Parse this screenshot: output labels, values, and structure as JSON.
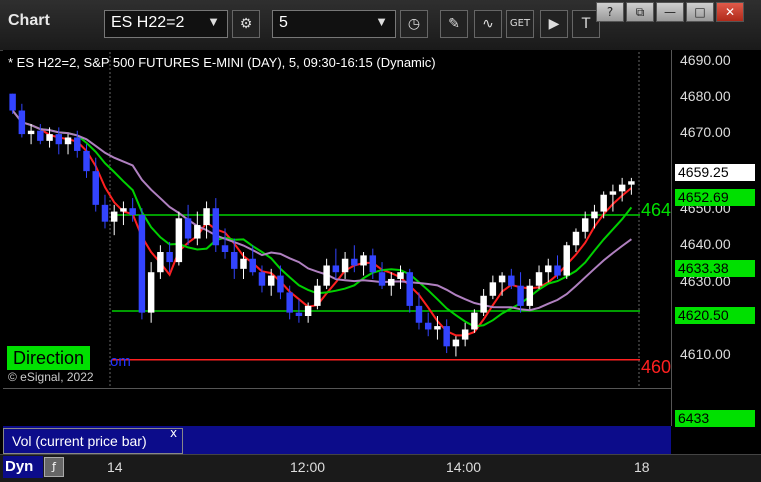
{
  "window": {
    "title": "Chart",
    "symbol": "ES H22=2",
    "interval": "5",
    "controls": [
      "?",
      "⧉",
      "—",
      "□",
      "✕"
    ]
  },
  "toolbar": {
    "icons": [
      "settings-icon",
      "clock-icon",
      "pencil-icon",
      "indicator-icon",
      "get-icon",
      "play-icon",
      "text-icon"
    ]
  },
  "chart": {
    "header": "* ES H22=2, S&P 500 FUTURES E-MINI (DAY), 5, 09:30-16:15 (Dynamic)",
    "direction_label": "Direction",
    "partial_text": "om",
    "copyright": "© eSignal, 2022",
    "y_ticks": [
      "4690.00",
      "4680.00",
      "4670.00",
      "4650.00",
      "4640.00",
      "4630.00",
      "4610.00"
    ],
    "price_tags": {
      "current": "4659.25",
      "upper_line": "4652.69",
      "ma": "4633.38",
      "lower_line": "4620.50"
    },
    "cut_labels": {
      "green": "464",
      "red": "460"
    },
    "colors": {
      "green": "#00d000",
      "red": "#ff2020",
      "blue": "#3344ff",
      "magenta": "#b080c0"
    }
  },
  "volume": {
    "label": "Vol (current price bar)",
    "close": "x",
    "value": "6433"
  },
  "bottom": {
    "dyn": "Dyn",
    "fx_icon": "function-icon",
    "x_ticks": [
      "14",
      "12:00",
      "14:00",
      "18"
    ]
  },
  "chart_data": {
    "type": "candlestick",
    "title": "ES H22=2, S&P 500 FUTURES E-MINI (DAY), 5, 09:30-16:15 (Dynamic)",
    "y_range": [
      4600,
      4695
    ],
    "x_ticks": [
      "14",
      "12:00",
      "14:00",
      "18"
    ],
    "candles": [
      [
        4685,
        4685,
        4679,
        4680
      ],
      [
        4680,
        4682,
        4672,
        4673
      ],
      [
        4673,
        4676,
        4670,
        4674
      ],
      [
        4674,
        4676,
        4670,
        4671
      ],
      [
        4671,
        4675,
        4669,
        4673
      ],
      [
        4673,
        4675,
        4667,
        4670
      ],
      [
        4670,
        4673,
        4667,
        4672
      ],
      [
        4672,
        4674,
        4666,
        4668
      ],
      [
        4668,
        4670,
        4660,
        4662
      ],
      [
        4662,
        4666,
        4650,
        4652
      ],
      [
        4652,
        4655,
        4645,
        4647
      ],
      [
        4647,
        4652,
        4643,
        4650
      ],
      [
        4650,
        4653,
        4646,
        4651
      ],
      [
        4651,
        4654,
        4647,
        4649
      ],
      [
        4649,
        4651,
        4618,
        4620
      ],
      [
        4620,
        4635,
        4617,
        4632
      ],
      [
        4632,
        4640,
        4630,
        4638
      ],
      [
        4638,
        4641,
        4632,
        4635
      ],
      [
        4635,
        4650,
        4634,
        4648
      ],
      [
        4648,
        4652,
        4640,
        4642
      ],
      [
        4642,
        4650,
        4640,
        4646
      ],
      [
        4646,
        4653,
        4642,
        4651
      ],
      [
        4651,
        4654,
        4638,
        4640
      ],
      [
        4640,
        4645,
        4636,
        4638
      ],
      [
        4638,
        4642,
        4630,
        4633
      ],
      [
        4633,
        4638,
        4630,
        4636
      ],
      [
        4636,
        4640,
        4631,
        4632
      ],
      [
        4632,
        4634,
        4626,
        4628
      ],
      [
        4628,
        4633,
        4625,
        4631
      ],
      [
        4631,
        4634,
        4624,
        4626
      ],
      [
        4626,
        4628,
        4618,
        4620
      ],
      [
        4620,
        4624,
        4617,
        4619
      ],
      [
        4619,
        4623,
        4617,
        4622
      ],
      [
        4622,
        4630,
        4621,
        4628
      ],
      [
        4628,
        4636,
        4627,
        4634
      ],
      [
        4634,
        4639,
        4630,
        4632
      ],
      [
        4632,
        4638,
        4630,
        4636
      ],
      [
        4636,
        4640,
        4632,
        4634
      ],
      [
        4634,
        4638,
        4631,
        4637
      ],
      [
        4637,
        4639,
        4630,
        4632
      ],
      [
        4632,
        4635,
        4627,
        4628
      ],
      [
        4628,
        4632,
        4625,
        4630
      ],
      [
        4630,
        4634,
        4627,
        4632
      ],
      [
        4632,
        4633,
        4620,
        4622
      ],
      [
        4622,
        4626,
        4615,
        4617
      ],
      [
        4617,
        4620,
        4613,
        4615
      ],
      [
        4615,
        4619,
        4612,
        4616
      ],
      [
        4616,
        4618,
        4608,
        4610
      ],
      [
        4610,
        4613,
        4607,
        4612
      ],
      [
        4612,
        4617,
        4610,
        4615
      ],
      [
        4615,
        4621,
        4614,
        4620
      ],
      [
        4620,
        4627,
        4619,
        4625
      ],
      [
        4625,
        4631,
        4624,
        4629
      ],
      [
        4629,
        4632,
        4625,
        4631
      ],
      [
        4631,
        4633,
        4627,
        4628
      ],
      [
        4628,
        4632,
        4620,
        4622
      ],
      [
        4622,
        4630,
        4621,
        4628
      ],
      [
        4628,
        4634,
        4627,
        4632
      ],
      [
        4632,
        4636,
        4629,
        4634
      ],
      [
        4634,
        4637,
        4630,
        4631
      ],
      [
        4631,
        4641,
        4630,
        4640
      ],
      [
        4640,
        4645,
        4638,
        4644
      ],
      [
        4644,
        4650,
        4642,
        4648
      ],
      [
        4648,
        4652,
        4645,
        4650
      ],
      [
        4650,
        4656,
        4648,
        4655
      ],
      [
        4655,
        4658,
        4650,
        4656
      ],
      [
        4656,
        4660,
        4653,
        4658
      ],
      [
        4658,
        4660,
        4655,
        4659
      ]
    ],
    "hlines": [
      {
        "value": 4649,
        "color": "green"
      },
      {
        "value": 4620.5,
        "color": "green"
      },
      {
        "value": 4606,
        "color": "red"
      }
    ]
  }
}
